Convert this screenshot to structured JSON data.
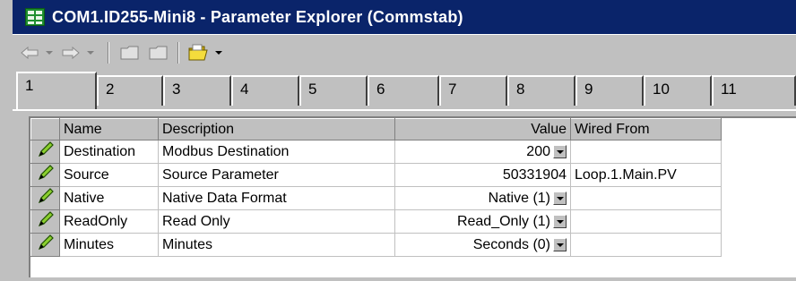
{
  "window": {
    "title": "COM1.ID255-Mini8 - Parameter Explorer (Commstab)"
  },
  "toolbar": {
    "back_icon": "back-arrow-icon",
    "forward_icon": "forward-arrow-icon",
    "folder_icon": "open-folder-icon"
  },
  "tabs": [
    {
      "label": "1"
    },
    {
      "label": "2"
    },
    {
      "label": "3"
    },
    {
      "label": "4"
    },
    {
      "label": "5"
    },
    {
      "label": "6"
    },
    {
      "label": "7"
    },
    {
      "label": "8"
    },
    {
      "label": "9"
    },
    {
      "label": "10"
    },
    {
      "label": "11"
    }
  ],
  "grid": {
    "columns": {
      "name": "Name",
      "description": "Description",
      "value": "Value",
      "wired_from": "Wired From"
    },
    "rows": [
      {
        "name": "Destination",
        "description": "Modbus Destination",
        "value": "200",
        "wired_from": ""
      },
      {
        "name": "Source",
        "description": "Source Parameter",
        "value": "50331904",
        "wired_from": "Loop.1.Main.PV"
      },
      {
        "name": "Native",
        "description": "Native Data Format",
        "value": "Native (1)",
        "wired_from": ""
      },
      {
        "name": "ReadOnly",
        "description": "Read Only",
        "value": "Read_Only (1)",
        "wired_from": ""
      },
      {
        "name": "Minutes",
        "description": "Minutes",
        "value": "Seconds (0)",
        "wired_from": ""
      }
    ]
  },
  "colors": {
    "titlebar": "#0a246a",
    "face": "#c0c0c0",
    "pencil": "#8ccf2f"
  }
}
